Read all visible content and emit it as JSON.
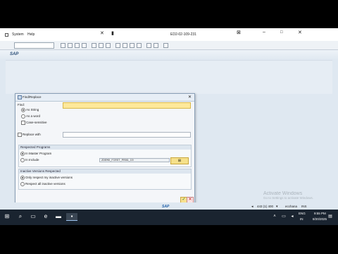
{
  "menubar": {
    "items": [
      "System",
      "Help"
    ],
    "server": "ED2-02-109-231"
  },
  "title_bar": {
    "title": "SAP"
  },
  "dialog": {
    "title": "Find/Replace",
    "find_label": "Find:",
    "find_value": "",
    "options": [
      "As String",
      "As a word",
      "Case-sensitive"
    ],
    "replace_label": "Replace with",
    "replace_value": "",
    "respected_programs_label": "Respected Programs",
    "in_master_program_label": "In Master Program",
    "in_include_label": "In Include",
    "include_value": "ZDEMO_FIRST_PROG_C0",
    "inactive_versions_label": "Inactive Versions Respected",
    "only_inactive_label": "Only respect my inactive versions",
    "all_inactive_label": "Respect all inactive versions"
  },
  "status": {
    "sap_logo": "SAP",
    "session": "443 (1) 400",
    "client": "ecchana",
    "mode": "INS"
  },
  "watermark": {
    "line1": "Activate Windows",
    "line2": "Go to Settings to activate Windows."
  },
  "taskbar": {
    "language": "ENG",
    "region": "IN",
    "time": "9:55 PM",
    "date": "8/20/2025"
  },
  "colors": {
    "find_field": "#fde89a",
    "sap_blue": "#2a4d77"
  }
}
